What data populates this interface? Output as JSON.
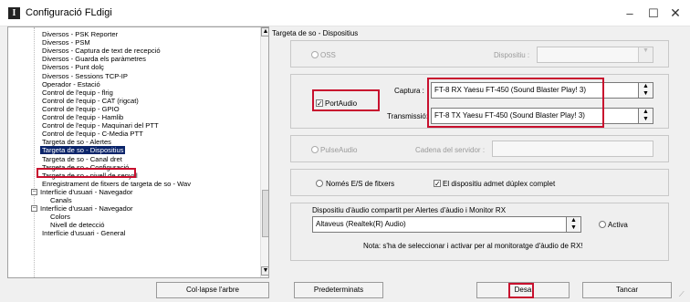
{
  "window": {
    "title": "Configuració FLdigi",
    "icon_name": "fldigi-app-icon",
    "minimize": "–",
    "maximize": "☐",
    "close": "✕"
  },
  "tree": {
    "items": [
      {
        "label": "Diversos - PSK Reporter",
        "kind": "leaf"
      },
      {
        "label": "Diversos - PSM",
        "kind": "leaf"
      },
      {
        "label": "Diversos - Captura de text de recepció",
        "kind": "leaf"
      },
      {
        "label": "Diversos - Guarda els paràmetres",
        "kind": "leaf"
      },
      {
        "label": "Diversos - Punt dolç",
        "kind": "leaf"
      },
      {
        "label": "Diversos - Sessions TCP-IP",
        "kind": "leaf"
      },
      {
        "label": "Operador - Estació",
        "kind": "leaf"
      },
      {
        "label": "Control de l'equip - flrig",
        "kind": "leaf"
      },
      {
        "label": "Control de l'equip - CAT (rigcat)",
        "kind": "leaf"
      },
      {
        "label": "Control de l'equip - GPIO",
        "kind": "leaf"
      },
      {
        "label": "Control de l'equip - Hamlib",
        "kind": "leaf"
      },
      {
        "label": "Control de l'equip - Maquinari del PTT",
        "kind": "leaf"
      },
      {
        "label": "Control de l'equip - C-Media PTT",
        "kind": "leaf"
      },
      {
        "label": "Targeta de so - Alertes",
        "kind": "leaf"
      },
      {
        "label": "Targeta de so - Dispositius",
        "kind": "selected"
      },
      {
        "label": "Targeta de so - Canal dret",
        "kind": "leaf"
      },
      {
        "label": "Targeta de so - Configuració",
        "kind": "leaf"
      },
      {
        "label": "Targeta de so - nivell de senyal",
        "kind": "leaf"
      },
      {
        "label": "Enregistrament de fitxers de targeta de so - Wav",
        "kind": "leaf"
      },
      {
        "label": "Interfície d'usuari - Navegador",
        "kind": "cat"
      },
      {
        "label": "Canals",
        "kind": "sub"
      },
      {
        "label": "Interfície d'usuari - Navegador",
        "kind": "cat"
      },
      {
        "label": "Colors",
        "kind": "sub"
      },
      {
        "label": "Nivell de detecció",
        "kind": "sub"
      },
      {
        "label": "Interfície d'usuari - General",
        "kind": "leaf"
      }
    ],
    "expander_symbol": "−",
    "collapse_button": "Col·lapse l'arbre"
  },
  "panel": {
    "title": "Targeta de so - Dispositius",
    "oss": {
      "label": "OSS",
      "device_label": "Dispositiu :",
      "device_value": ""
    },
    "portaudio": {
      "label": "PortAudio",
      "checked": true,
      "capture_label": "Captura :",
      "capture_value": "FT-8 RX Yaesu FT-450 (Sound Blaster Play! 3)",
      "playback_label": "Transmissió:",
      "playback_value": "FT-8 TX Yaesu FT-450 (Sound Blaster Play! 3)"
    },
    "pulseaudio": {
      "label": "PulseAudio",
      "server_label": "Cadena del servidor :",
      "server_value": ""
    },
    "files_only": {
      "label": "Només E/S de fitxers"
    },
    "duplex": {
      "label": "El dispositiu admet dúplex complet",
      "checked": true
    },
    "shared": {
      "label": "Dispositiu d'àudio compartit per Alertes d'àudio i Monitor RX",
      "value": "Altaveus (Realtek(R) Audio)",
      "active_label": "Activa",
      "note": "Nota: s'ha de seleccionar i activar per al monitoratge d'àudio de RX!"
    },
    "check_mark": "✓",
    "combo_arrow": "▲▼"
  },
  "buttons": {
    "defaults": "Predeterminats",
    "save": "Desa",
    "cancel": "Tancar"
  },
  "colors": {
    "selection": "#0a246a",
    "annotation": "#c8102e"
  }
}
